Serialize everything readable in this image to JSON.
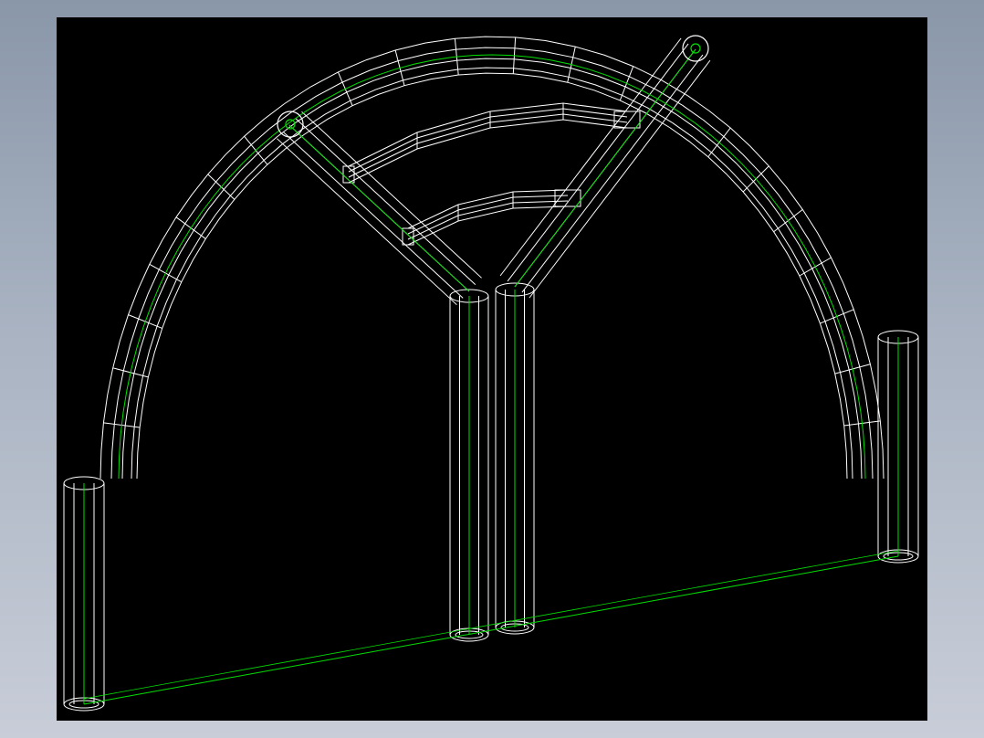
{
  "view": {
    "background_color": "#000000",
    "frame_gradient": [
      "#8a97a9",
      "#a9b3c2",
      "#c8cdd8"
    ]
  },
  "model": {
    "render_mode": "wireframe",
    "edge_color": "#ffffff",
    "axis_color": "#00e000",
    "parts": [
      "left-arch-tube",
      "right-arch-tube",
      "top-arch-segment",
      "left-diagonal-brace",
      "right-diagonal-brace",
      "upper-curved-rail",
      "lower-curved-rail",
      "left-center-post",
      "right-center-post",
      "ground-centerline"
    ]
  }
}
